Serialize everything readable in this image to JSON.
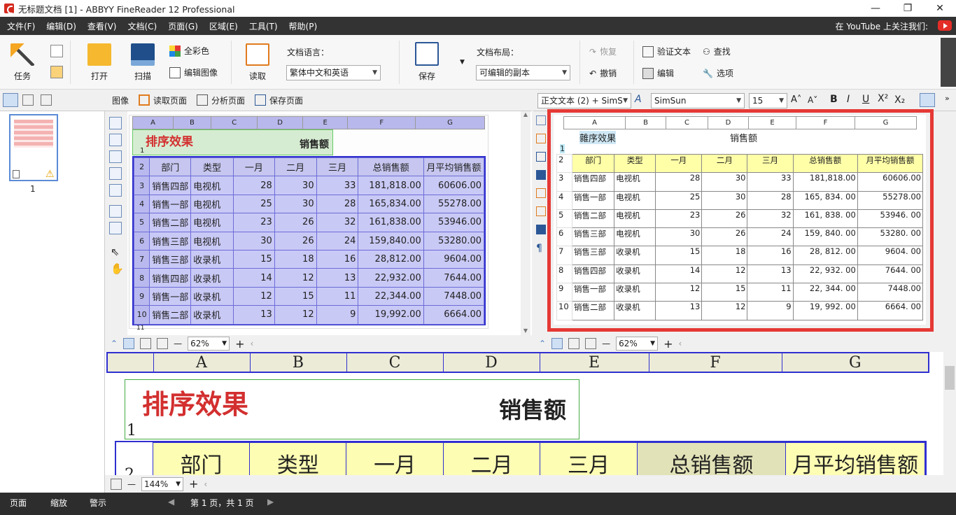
{
  "window": {
    "title": "无标题文档 [1] - ABBYY FineReader 12 Professional",
    "minimize": "—",
    "restore": "❐",
    "close": "✕"
  },
  "menu": {
    "items": [
      "文件(F)",
      "编辑(D)",
      "查看(V)",
      "文档(C)",
      "页面(G)",
      "区域(E)",
      "工具(T)",
      "帮助(P)"
    ],
    "youtube_text": "在 YouTube 上关注我们:"
  },
  "toolbar": {
    "task": "任务",
    "open": "打开",
    "scan": "扫描",
    "full_color": "全彩色",
    "edit_image": "编辑图像",
    "read": "读取",
    "doc_lang_label": "文档语言：",
    "doc_lang_value": "繁体中文和英语",
    "save": "保存",
    "doc_layout_label": "文档布局：",
    "doc_layout_value": "可编辑的副本",
    "redo": "恢复",
    "undo": "撤销",
    "verify": "验证文本",
    "edit": "编辑",
    "find": "查找",
    "options": "选项"
  },
  "image_pane": {
    "title": "图像",
    "read_page": "读取页面",
    "analyze_page": "分析页面",
    "save_page": "保存页面",
    "zoom": "62%"
  },
  "text_pane": {
    "style": "正文文本 (2) + SimS",
    "font": "SimSun",
    "size": "15",
    "zoom": "62%"
  },
  "pages_pane": {
    "page_number": "1"
  },
  "sheet": {
    "columns": [
      "A",
      "B",
      "C",
      "D",
      "E",
      "F",
      "G"
    ],
    "title": "排序效果",
    "subtitle": "销售额",
    "headers": [
      "部门",
      "类型",
      "一月",
      "二月",
      "三月",
      "总销售额",
      "月平均销售额"
    ],
    "rows": [
      [
        "销售四部",
        "电视机",
        "28",
        "30",
        "33",
        "181,818.00",
        "60606.00"
      ],
      [
        "销售一部",
        "电视机",
        "25",
        "30",
        "28",
        "165,834.00",
        "55278.00"
      ],
      [
        "销售二部",
        "电视机",
        "23",
        "26",
        "32",
        "161,838.00",
        "53946.00"
      ],
      [
        "销售三部",
        "电视机",
        "30",
        "26",
        "24",
        "159,840.00",
        "53280.00"
      ],
      [
        "销售三部",
        "收录机",
        "15",
        "18",
        "16",
        "28,812.00",
        "9604.00"
      ],
      [
        "销售四部",
        "收录机",
        "14",
        "12",
        "13",
        "22,932.00",
        "7644.00"
      ],
      [
        "销售一部",
        "收录机",
        "12",
        "15",
        "11",
        "22,344.00",
        "7448.00"
      ],
      [
        "销售二部",
        "收录机",
        "13",
        "12",
        "9",
        "19,992.00",
        "6664.00"
      ]
    ],
    "row_numbers": [
      "1",
      "2",
      "3",
      "4",
      "5",
      "6",
      "7",
      "8",
      "9",
      "10",
      "11"
    ]
  },
  "text_sheet": {
    "title": "雜序效果",
    "subtitle": "销售额",
    "headers": [
      "部门",
      "类型",
      "一月",
      "二月",
      "三月",
      "总销售额",
      "月平均销售额"
    ],
    "rows": [
      [
        "销售四部",
        "电视机",
        "28",
        "30",
        "33",
        "181,818.00",
        "60606.00"
      ],
      [
        "销售一部",
        "电视机",
        "25",
        "30",
        "28",
        "165, 834. 00",
        "55278.00"
      ],
      [
        "销售二部",
        "电视机",
        "23",
        "26",
        "32",
        "161, 838. 00",
        "53946. 00"
      ],
      [
        "销售三部",
        "电视机",
        "30",
        "26",
        "24",
        "159, 840. 00",
        "53280. 00"
      ],
      [
        "销售三部",
        "收录机",
        "15",
        "18",
        "16",
        "28, 812. 00",
        "9604. 00"
      ],
      [
        "销售四部",
        "收录机",
        "14",
        "12",
        "13",
        "22, 932. 00",
        "7644. 00"
      ],
      [
        "销售一部",
        "收录机",
        "12",
        "15",
        "11",
        "22, 344. 00",
        "7448.00"
      ],
      [
        "销售二部",
        "收录机",
        "13",
        "12",
        "9",
        "19, 992. 00",
        "6664. 00"
      ]
    ]
  },
  "zoom_pane": {
    "zoom": "144%"
  },
  "status": {
    "pages_tab": "页面",
    "zoom_tab": "缩放",
    "warning_tab": "警示",
    "page_info": "第 1 页，共 1 页"
  },
  "colors": {
    "highlight_red": "#e53935",
    "region_blue": "#2f2fd0",
    "table_header_yellow": "#ffffa8"
  }
}
